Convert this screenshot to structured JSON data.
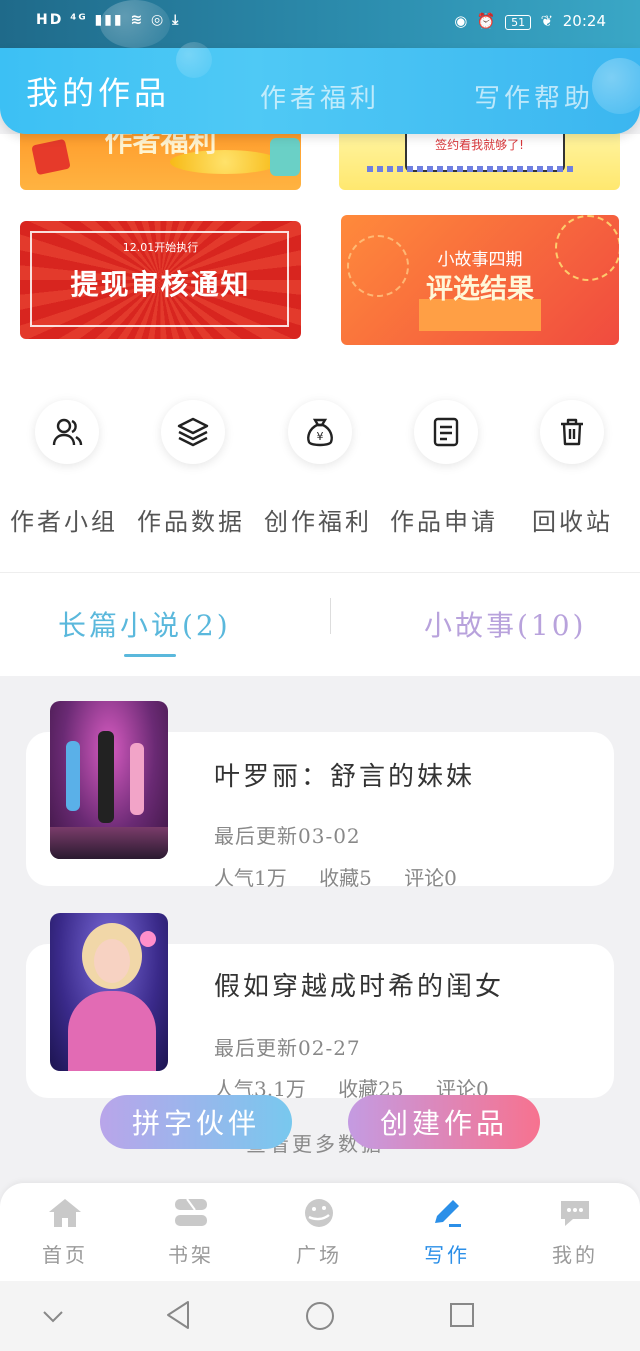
{
  "status_bar": {
    "left": "HD ⁴ᴳ ▮▮▮ ≋ ◎ ⤓",
    "battery": "51",
    "time": "20:24"
  },
  "header": {
    "tabs": [
      {
        "label": "我的作品"
      },
      {
        "label": "作者福利"
      },
      {
        "label": "写作帮助"
      }
    ]
  },
  "banners": [
    {
      "text": "作者福利"
    },
    {
      "text": "签约看我就够了!"
    },
    {
      "text": "提现审核通知",
      "sub": "12.01开始执行"
    },
    {
      "text": "评选结果",
      "sub": "小故事四期"
    }
  ],
  "quick_actions": [
    {
      "label": "作者小组",
      "icon": "users-icon"
    },
    {
      "label": "作品数据",
      "icon": "layers-icon"
    },
    {
      "label": "创作福利",
      "icon": "money-bag-icon"
    },
    {
      "label": "作品申请",
      "icon": "document-icon"
    },
    {
      "label": "回收站",
      "icon": "trash-icon"
    }
  ],
  "categories": [
    {
      "label": "长篇小说(2)",
      "active": true
    },
    {
      "label": "小故事(10)",
      "active": false
    }
  ],
  "works": [
    {
      "title": "叶罗丽：舒言的妹妹",
      "updated": "最后更新03-02",
      "popularity": "人气1万",
      "favorites": "收藏5",
      "comments": "评论0"
    },
    {
      "title": "假如穿越成时希的闺女",
      "updated": "最后更新02-27",
      "popularity": "人气3.1万",
      "favorites": "收藏25",
      "comments": "评论0"
    }
  ],
  "load_more": "查看更多数据",
  "float_buttons": {
    "partner": "拼字伙伴",
    "create": "创建作品"
  },
  "bottom_nav": [
    {
      "label": "首页",
      "icon": "home-icon"
    },
    {
      "label": "书架",
      "icon": "bookshelf-icon"
    },
    {
      "label": "广场",
      "icon": "planet-icon"
    },
    {
      "label": "写作",
      "icon": "pen-icon",
      "active": true
    },
    {
      "label": "我的",
      "icon": "chat-bubble-icon"
    }
  ],
  "colors": {
    "header": "#4fc9f5",
    "accent": "#2b8fe8",
    "active_category": "#5ab8dc",
    "inactive_category": "#b8a2dc"
  }
}
